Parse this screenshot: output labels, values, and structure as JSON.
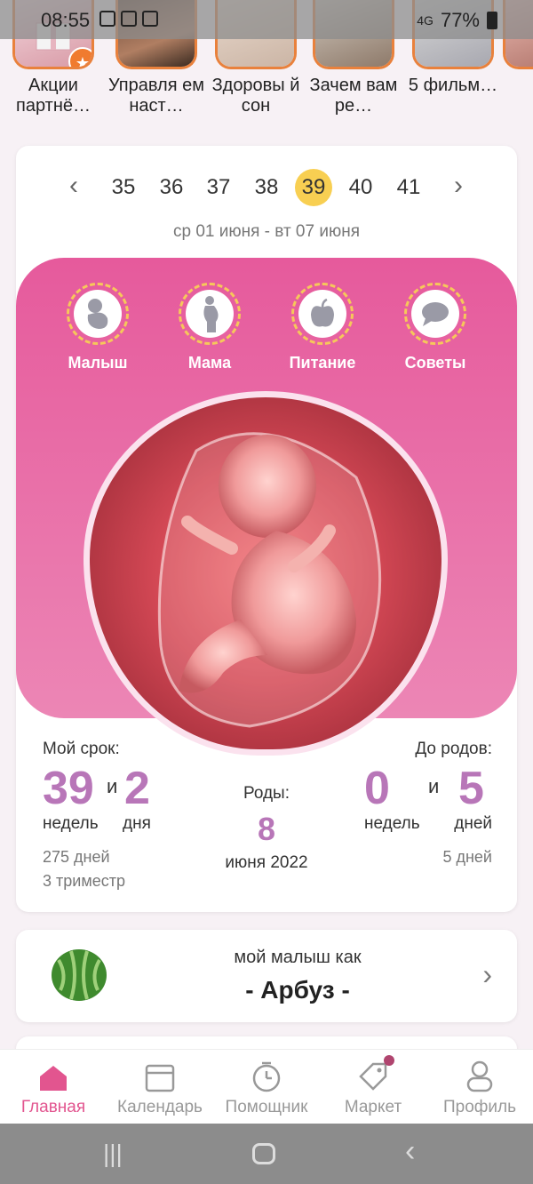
{
  "status_bar": {
    "time": "08:55",
    "battery": "77%",
    "network": "4G"
  },
  "stories": [
    {
      "label": "Акции партнё…",
      "icon": "gift-icon",
      "badge": "★"
    },
    {
      "label": "Управля ем наст…",
      "icon": "woman-photo"
    },
    {
      "label": "Здоровы й сон",
      "icon": "sleep-photo"
    },
    {
      "label": "Зачем вам ре…",
      "icon": "woman-photo"
    },
    {
      "label": "5 фильм…",
      "icon": "pregnant-photo"
    }
  ],
  "week_nav": {
    "weeks": [
      "35",
      "36",
      "37",
      "38",
      "39",
      "40",
      "41"
    ],
    "active_week": "39",
    "date_range": "ср 01 июня - вт 07 июня"
  },
  "categories": [
    {
      "label": "Малыш",
      "icon": "baby-icon"
    },
    {
      "label": "Мама",
      "icon": "mother-icon"
    },
    {
      "label": "Питание",
      "icon": "apple-icon"
    },
    {
      "label": "Советы",
      "icon": "chat-bubble-icon"
    }
  ],
  "term": {
    "title": "Мой срок:",
    "weeks": "39",
    "weeks_unit": "недель",
    "and": "и",
    "days": "2",
    "days_unit": "дня",
    "total_days": "275 дней",
    "trimester": "3 триместр"
  },
  "birth": {
    "title": "Роды:",
    "day": "8",
    "month_year": "июня 2022"
  },
  "until": {
    "title": "До родов:",
    "weeks": "0",
    "weeks_unit": "недель",
    "and": "и",
    "days": "5",
    "days_unit": "дней",
    "total_days": "5 дней"
  },
  "baby_size": {
    "caption": "мой малыш как",
    "fruit": "- Арбуз -"
  },
  "bottom_nav": [
    {
      "label": "Главная",
      "icon": "home-icon",
      "active": true
    },
    {
      "label": "Календарь",
      "icon": "calendar-icon"
    },
    {
      "label": "Помощник",
      "icon": "timer-icon"
    },
    {
      "label": "Маркет",
      "icon": "tag-icon"
    },
    {
      "label": "Профиль",
      "icon": "person-icon"
    }
  ],
  "colors": {
    "accent_pink": "#e2558f",
    "stat_purple": "#b876b8",
    "active_week": "#f8cf52",
    "story_ring": "#e9813c"
  }
}
